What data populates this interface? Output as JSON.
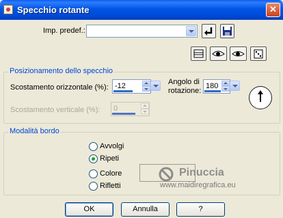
{
  "window": {
    "title": "Specchio rotante",
    "close_symbol": "✕"
  },
  "preset": {
    "label": "Imp. predef.:",
    "value": ""
  },
  "mirror_position": {
    "title": "Posizionamento dello specchio",
    "horizontal_label": "Scostamento orizzontale (%):",
    "horizontal_value": "-12",
    "vertical_label": "Scostamento verticale (%):",
    "vertical_value": "0",
    "angle_label_line1": "Angolo di",
    "angle_label_line2": "rotazione:",
    "angle_value": "180"
  },
  "edge_mode": {
    "title": "Modalità bordo",
    "options": [
      "Avvolgi",
      "Ripeti",
      "Colore",
      "Rifletti"
    ],
    "selected": "Ripeti"
  },
  "watermark": {
    "name": "Pinuccia",
    "url": "www.maidiregrafica.eu"
  },
  "buttons": {
    "ok": "OK",
    "cancel": "Annulla",
    "help": "?"
  }
}
